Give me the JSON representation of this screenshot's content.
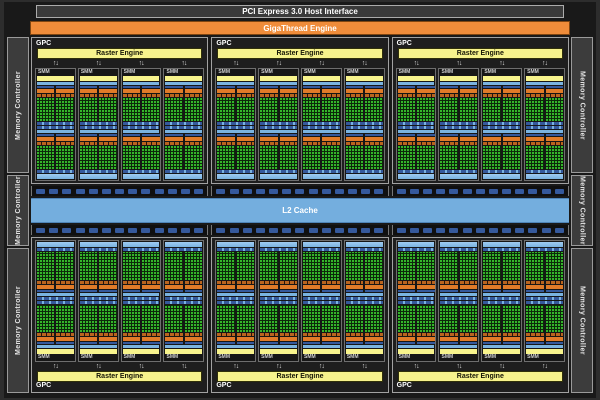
{
  "top_bars": {
    "pcie_label": "PCI Express 3.0 Host Interface",
    "gigathread_label": "GigaThread Engine"
  },
  "l2_cache": {
    "label": "L2 Cache"
  },
  "gpc": {
    "label": "GPC",
    "raster_engine_label": "Raster Engine",
    "smm_label": "SMM",
    "top_row_count": 3,
    "bottom_row_count": 3,
    "smm_per_gpc": 4,
    "arrow_glyph": "↑↓"
  },
  "smm_structure": {
    "processing_blocks_per_smm": 2,
    "halves_per_block": 2,
    "core_columns_per_half": 4,
    "core_rows_per_block": 8
  },
  "memory_controller": {
    "label": "Memory Controller",
    "left_count": 3,
    "right_count": 3
  },
  "rop_rows": {
    "rows": 2,
    "groups_per_row": 3,
    "dashes_per_group": 13
  },
  "colors": {
    "gigathread_orange": "#ef8c3a",
    "raster_smm_yellow": "#f7f38c",
    "core_green": "#34b42a",
    "light_blue": "#7ab3e0",
    "dark_blue": "#35599c",
    "warp_orange": "#e07b28",
    "l2_blue": "#74aede",
    "panel_gray": "#3c3c3c"
  }
}
